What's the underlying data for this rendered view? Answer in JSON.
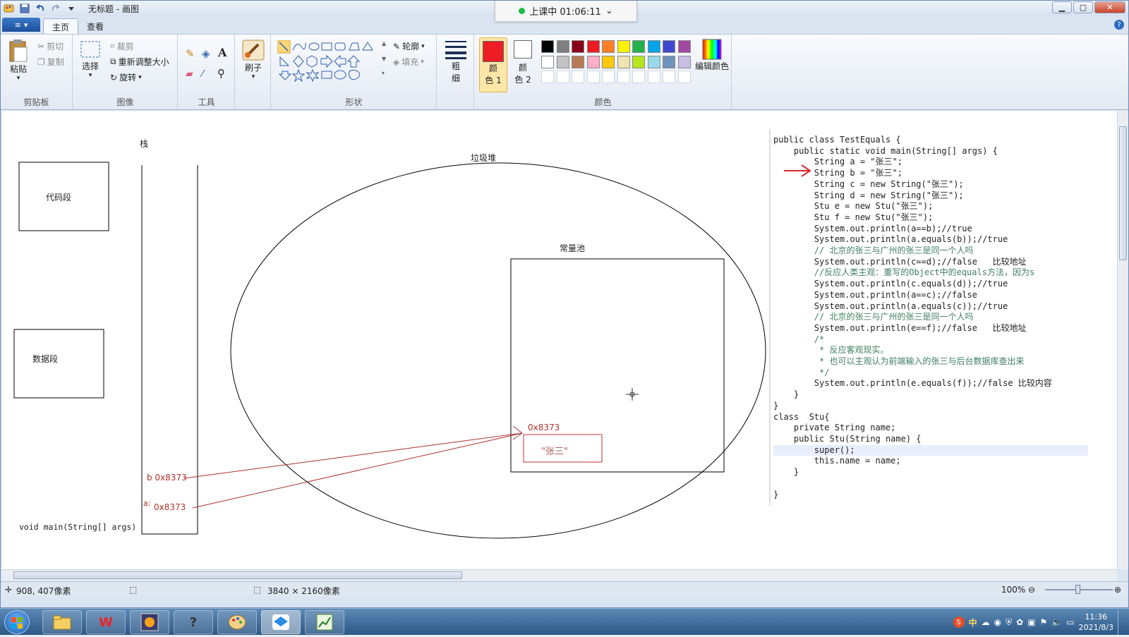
{
  "window": {
    "title": "无标题 - 画图",
    "minimize": "▁",
    "maximize": "▢",
    "close": "✕"
  },
  "class_status": {
    "label": "上课中 01:06:11",
    "chevron": "⌄"
  },
  "tabs": {
    "app_menu": "≡",
    "home": "主页",
    "view": "查看",
    "help": "?"
  },
  "ribbon": {
    "clipboard": {
      "group": "剪贴板",
      "paste": "粘贴",
      "cut": "剪切",
      "copy": "复制"
    },
    "image": {
      "group": "图像",
      "select": "选择",
      "crop": "裁剪",
      "resize": "重新调整大小",
      "rotate": "旋转"
    },
    "tools": {
      "group": "工具"
    },
    "brushes": {
      "label": "刷子"
    },
    "shapes": {
      "group": "形状",
      "outline": "轮廓",
      "fill": "填充"
    },
    "size": {
      "label1": "粗",
      "label2": "细"
    },
    "colors": {
      "group": "颜色",
      "color1_a": "颜",
      "color1_b": "色 1",
      "color2_a": "颜",
      "color2_b": "色 2",
      "edit": "编辑颜色",
      "color1_value": "#ee1c24",
      "color2_value": "#ffffff",
      "palette_row1": [
        "#000000",
        "#7f7f7f",
        "#880015",
        "#ed1c24",
        "#ff7f27",
        "#fff200",
        "#22b14c",
        "#00a2e8",
        "#3f48cc",
        "#a349a4"
      ],
      "palette_row2": [
        "#ffffff",
        "#c3c3c3",
        "#b97a57",
        "#ffaec9",
        "#ffc90e",
        "#efe4b0",
        "#b5e61d",
        "#99d9ea",
        "#7092be",
        "#c8bfe7"
      ]
    }
  },
  "drawing": {
    "stack_label": "栈",
    "code_segment": "代码段",
    "data_segment": "数据段",
    "heap_label": "垃圾堆",
    "const_pool": "常量池",
    "addr_top": "0x8373",
    "str_value": "\"张三\"",
    "var_b": "b  0x8373",
    "var_a_prefix": "a:",
    "var_a_addr": "0x8373",
    "main_sig": "void main(String[] args)"
  },
  "code_lines": [
    {
      "t": "public class TestEquals {"
    },
    {
      "t": "    public static void main(String[] args) {"
    },
    {
      "t": "        String a = \"张三\";"
    },
    {
      "t": "        String b = \"张三\";"
    },
    {
      "t": "        String c = new String(\"张三\");"
    },
    {
      "t": "        String d = new String(\"张三\");"
    },
    {
      "t": "        Stu e = new Stu(\"张三\");"
    },
    {
      "t": "        Stu f = new Stu(\"张三\");"
    },
    {
      "t": "        System.out.println(a==b);//true"
    },
    {
      "t": "        System.out.println(a.equals(b));//true"
    },
    {
      "t": "        // 北京的张三与广州的张三是同一个人吗"
    },
    {
      "t": "        System.out.println(c==d);//false   比较地址"
    },
    {
      "t": "        //反应人类主观：重写的Object中的equals方法，因为s"
    },
    {
      "t": "        System.out.println(c.equals(d));//true"
    },
    {
      "t": "        System.out.println(a==c);//false"
    },
    {
      "t": "        System.out.println(a.equals(c));//true"
    },
    {
      "t": "        // 北京的张三与广州的张三是同一个人吗"
    },
    {
      "t": "        System.out.println(e==f);//false   比较地址"
    },
    {
      "t": "        /*"
    },
    {
      "t": "         * 反应客观现实。"
    },
    {
      "t": "         * 也可以主观认为前端输入的张三与后台数据库查出来"
    },
    {
      "t": "         */"
    },
    {
      "t": "        System.out.println(e.equals(f));//false 比较内容"
    },
    {
      "t": "    }"
    },
    {
      "t": "}"
    },
    {
      "t": "class  Stu{"
    },
    {
      "t": "    private String name;"
    },
    {
      "t": "    public Stu(String name) {"
    },
    {
      "t": "        super();"
    },
    {
      "t": "        this.name = name;"
    },
    {
      "t": "    }"
    },
    {
      "t": ""
    },
    {
      "t": "}"
    }
  ],
  "status": {
    "cursor_pos": "908, 407像素",
    "canvas_size": "3840 × 2160像素",
    "zoom": "100%"
  },
  "taskbar": {
    "clock_time": "11:36",
    "clock_date": "2021/8/3",
    "ime": "中"
  }
}
